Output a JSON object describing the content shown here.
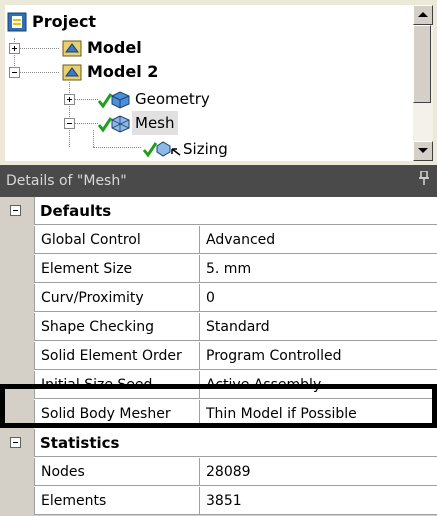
{
  "tree": {
    "project": "Project",
    "model": "Model",
    "model2": "Model 2",
    "geometry": "Geometry",
    "mesh": "Mesh",
    "sizing": "Sizing"
  },
  "details": {
    "title": "Details of \"Mesh\""
  },
  "defaults": {
    "header": "Defaults",
    "rows": [
      {
        "name": "Global Control",
        "value": "Advanced"
      },
      {
        "name": "Element Size",
        "value": "5. mm"
      },
      {
        "name": "Curv/Proximity",
        "value": "0"
      },
      {
        "name": "Shape Checking",
        "value": "Standard"
      },
      {
        "name": "Solid Element Order",
        "value": "Program Controlled"
      },
      {
        "name": "Initial Size Seed",
        "value": "Active Assembly"
      },
      {
        "name": "Solid Body Mesher",
        "value": "Thin Model if Possible"
      }
    ]
  },
  "statistics": {
    "header": "Statistics",
    "rows": [
      {
        "name": "Nodes",
        "value": "28089"
      },
      {
        "name": "Elements",
        "value": "3851"
      }
    ]
  },
  "colors": {
    "details_header_bg": "#4a4a4a",
    "highlight_border": "#000000"
  }
}
